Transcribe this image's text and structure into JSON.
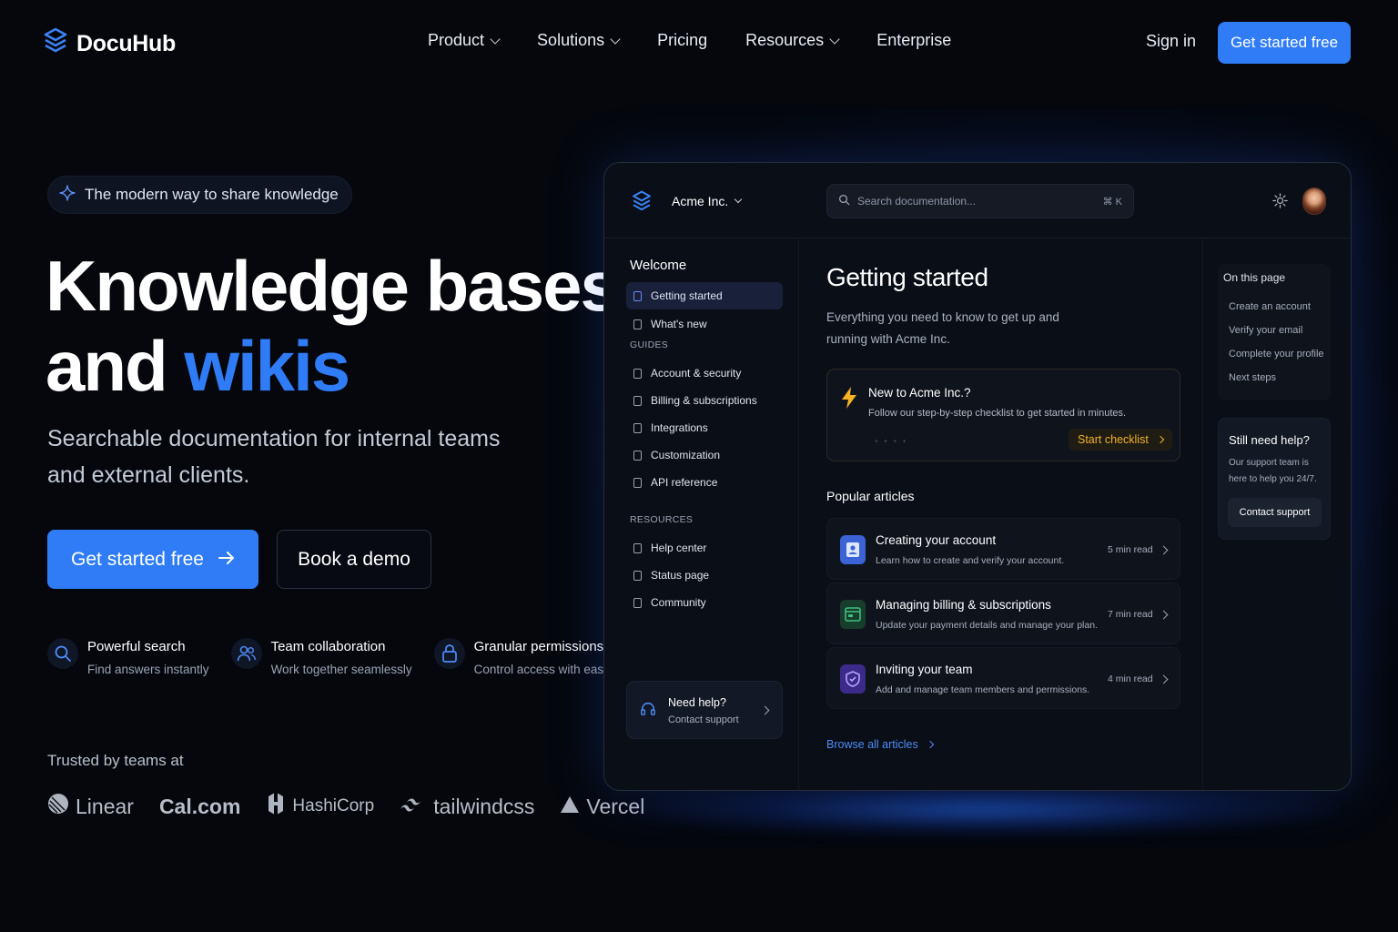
{
  "brand": {
    "name": "DocuHub",
    "accent": "#2f7cf6"
  },
  "nav": {
    "links": [
      {
        "label": "Product",
        "dropdown": true
      },
      {
        "label": "Solutions",
        "dropdown": true
      },
      {
        "label": "Pricing",
        "dropdown": false
      },
      {
        "label": "Resources",
        "dropdown": true
      },
      {
        "label": "Enterprise",
        "dropdown": false
      }
    ],
    "sign_in": "Sign in",
    "cta": "Get started free"
  },
  "hero": {
    "badge": "The modern way to share knowledge",
    "title_line1": "Knowledge bases",
    "title_line2_prefix": "and",
    "title_line2_accent": "wikis",
    "subtitle": "Searchable documentation for internal teams and external clients.",
    "primary_cta": "Get started free",
    "secondary_cta": "Book a demo",
    "features": [
      {
        "title": "Powerful search",
        "desc": "Find answers instantly",
        "icon": "search-icon"
      },
      {
        "title": "Team collaboration",
        "desc": "Work together seamlessly",
        "icon": "users-icon"
      },
      {
        "title": "Granular permissions",
        "desc": "Control access with ease",
        "icon": "lock-icon"
      }
    ],
    "trusted_label": "Trusted by teams at",
    "logos": [
      "Linear",
      "Cal.com",
      "HashiCorp",
      "tailwindcss",
      "Vercel"
    ]
  },
  "app": {
    "org": "Acme Inc.",
    "search_placeholder": "Search documentation...",
    "search_shortcut": "⌘ K",
    "sidebar": {
      "heading": "Welcome",
      "top_items": [
        "Getting started",
        "What's new"
      ],
      "guides_label": "GUIDES",
      "guides": [
        "Account & security",
        "Billing & subscriptions",
        "Integrations",
        "Customization",
        "API reference"
      ],
      "resources_label": "RESOURCES",
      "resources": [
        "Help center",
        "Status page",
        "Community"
      ],
      "help_title": "Need help?",
      "help_sub": "Contact support"
    },
    "main": {
      "title": "Getting started",
      "desc": "Everything you need to know to get up and running with Acme Inc.",
      "callout_title": "New to Acme Inc.?",
      "callout_desc": "Follow our step-by-step checklist to get started in minutes.",
      "callout_button": "Start checklist",
      "popular_label": "Popular articles",
      "articles": [
        {
          "title": "Creating your account",
          "desc": "Learn how to create and verify your account.",
          "read": "5 min read",
          "icon": "user-card-icon",
          "color": "#3b63d6"
        },
        {
          "title": "Managing billing & subscriptions",
          "desc": "Update your payment details and manage your plan.",
          "read": "7 min read",
          "icon": "billing-icon",
          "color": "#1f6b4a"
        },
        {
          "title": "Inviting your team",
          "desc": "Add and manage team members and permissions.",
          "read": "4 min read",
          "icon": "shield-icon",
          "color": "#5b3fd0"
        }
      ],
      "browse_all": "Browse all articles"
    },
    "rail": {
      "toc_title": "On this page",
      "toc": [
        "Create an account",
        "Verify your email",
        "Complete your profile",
        "Next steps"
      ],
      "still_title": "Still need help?",
      "still_desc": "Our support team is here to help you 24/7.",
      "still_button": "Contact support"
    }
  }
}
